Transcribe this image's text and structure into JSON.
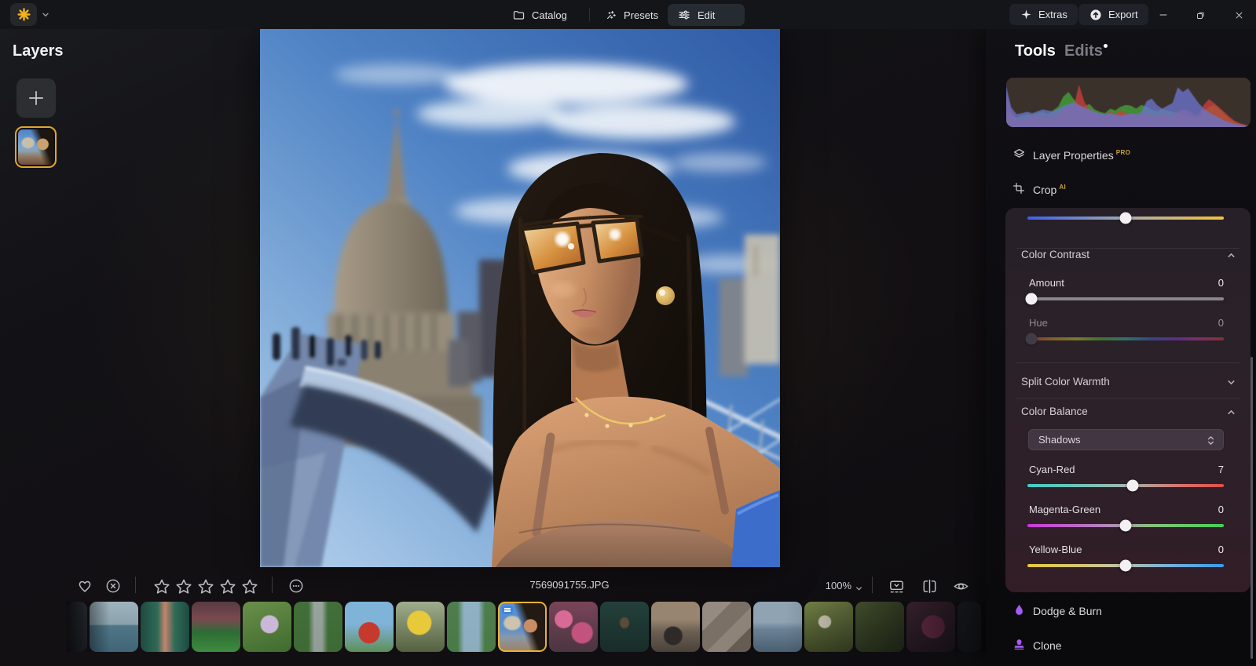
{
  "topbar": {
    "tabs": [
      {
        "label": "Catalog"
      },
      {
        "label": "Presets"
      },
      {
        "label": "Edit"
      }
    ],
    "extras_label": "Extras",
    "export_label": "Export"
  },
  "layers_panel": {
    "title": "Layers"
  },
  "viewer": {
    "filename": "7569091755.JPG",
    "zoom_level": "100%",
    "star_count": 5
  },
  "right_panel": {
    "tools_tab": "Tools",
    "edits_tab": "Edits",
    "layer_properties": {
      "label": "Layer Properties",
      "badge": "PRO"
    },
    "crop": {
      "label": "Crop",
      "badge": "AI"
    },
    "color_contrast": {
      "title": "Color Contrast",
      "amount": {
        "label": "Amount",
        "value": "0"
      },
      "hue": {
        "label": "Hue",
        "value": "0"
      }
    },
    "split_color_warmth": {
      "title": "Split Color Warmth"
    },
    "color_balance": {
      "title": "Color Balance",
      "range_selector": "Shadows",
      "cyan_red": {
        "label": "Cyan-Red",
        "value": "7"
      },
      "magenta_green": {
        "label": "Magenta-Green",
        "value": "0"
      },
      "yellow_blue": {
        "label": "Yellow-Blue",
        "value": "0"
      }
    },
    "dodge_burn": "Dodge & Burn",
    "clone": "Clone"
  },
  "histogram": {
    "red": [
      0.72,
      0.32,
      0.18,
      0.16,
      0.2,
      0.23,
      0.26,
      0.23,
      0.2,
      0.26,
      0.28,
      0.38,
      0.48,
      0.44,
      0.92,
      0.56,
      0.38,
      0.33,
      0.28,
      0.26,
      0.33,
      0.28,
      0.36,
      0.3,
      0.28,
      0.26,
      0.3,
      0.28,
      0.26,
      0.23,
      0.28,
      0.26,
      0.23,
      0.33,
      0.38,
      0.36,
      0.28,
      0.26,
      0.48,
      0.6,
      0.52,
      0.42,
      0.32,
      0.22,
      0.13,
      0.08,
      0.05,
      0.03
    ],
    "green": [
      0.34,
      0.28,
      0.2,
      0.24,
      0.28,
      0.26,
      0.3,
      0.33,
      0.28,
      0.36,
      0.44,
      0.66,
      0.76,
      0.6,
      0.48,
      0.44,
      0.5,
      0.38,
      0.33,
      0.3,
      0.4,
      0.36,
      0.44,
      0.48,
      0.46,
      0.4,
      0.48,
      0.44,
      0.38,
      0.34,
      0.4,
      0.36,
      0.33,
      0.3,
      0.27,
      0.24,
      0.22,
      0.2,
      0.34,
      0.44,
      0.48,
      0.4,
      0.28,
      0.18,
      0.11,
      0.07,
      0.04,
      0.02
    ],
    "blue": [
      0.88,
      0.42,
      0.28,
      0.3,
      0.33,
      0.3,
      0.34,
      0.38,
      0.36,
      0.34,
      0.4,
      0.46,
      0.5,
      0.54,
      0.48,
      0.42,
      0.38,
      0.33,
      0.3,
      0.28,
      0.3,
      0.27,
      0.25,
      0.27,
      0.3,
      0.28,
      0.32,
      0.56,
      0.62,
      0.48,
      0.4,
      0.46,
      0.52,
      0.86,
      0.76,
      0.84,
      0.68,
      0.52,
      0.4,
      0.32,
      0.26,
      0.2,
      0.14,
      0.1,
      0.07,
      0.05,
      0.03,
      0.02
    ]
  },
  "filmstrip": [
    {
      "name": "thumb-edge-left",
      "partial": "l",
      "bg": "linear-gradient(180deg,#3a4148,#262b31)"
    },
    {
      "name": "thumb-sea",
      "bg": "linear-gradient(180deg,#9fb3bd 0%,#8aa2ad 45%,#4f7587 48%,#3f6577 100%)"
    },
    {
      "name": "thumb-corridor",
      "bg": "linear-gradient(90deg,#1d4a41,#2f6b57 35%,#c4836f 50%,#2f6b57 70%,#1d4a41)"
    },
    {
      "name": "thumb-stadium",
      "bg": "linear-gradient(180deg,#5a3a42 0%,#7a4a50 35%,#2e6b35 60%,#3e8c3e 100%)"
    },
    {
      "name": "thumb-flower",
      "bg": "radial-gradient(circle at 55% 45%,#c9b8d8 0 22%,rgba(0,0,0,0) 25%),linear-gradient(160deg,#6a8f4a,#3f6b2f)"
    },
    {
      "name": "thumb-forest-path",
      "bg": "linear-gradient(90deg,rgba(62,107,53,.95) 0 30%,rgba(154,163,160,.9) 42% 58%,rgba(62,107,53,.95) 70%),linear-gradient(180deg,#7fae8f,#2f5429)"
    },
    {
      "name": "thumb-person-red",
      "bg": "radial-gradient(circle at 50% 62%,#c63a2e 0 26%,rgba(0,0,0,0) 28%),linear-gradient(180deg,#7fb3d8 0 45%,#5e8f5a 100%)"
    },
    {
      "name": "thumb-sunflower",
      "bg": "radial-gradient(circle at 48% 42%,#e8c93a 0 30%,rgba(0,0,0,0) 33%),linear-gradient(180deg,#9fae8f,#55603f)"
    },
    {
      "name": "thumb-canal",
      "bg": "linear-gradient(90deg,rgba(74,122,70,.95) 0 22%,rgba(143,176,196,.95) 35% 65%,rgba(74,122,70,.95) 78%),linear-gradient(180deg,#a8c4d4,#3e6b3a)"
    },
    {
      "name": "thumb-selected-portrait",
      "selected": true,
      "badge": true,
      "bg": "radial-gradient(circle at 68% 48%,#c98e63 0 16%,rgba(0,0,0,0) 18%),linear-gradient(250deg,#241a14 0 36%,rgba(0,0,0,0) 52%),radial-gradient(ellipse at 28% 42%,#cdc3ae 0 16%,rgba(0,0,0,0) 21%),linear-gradient(180deg,#5b8fce 0 55%,#8a98a8 72%,#9b8468 100%)"
    },
    {
      "name": "thumb-pink-flowers",
      "bg": "radial-gradient(circle at 30% 35%,#d86a96 0 18%,rgba(0,0,0,0) 20%),radial-gradient(circle at 68% 62%,#c2527e 0 22%,rgba(0,0,0,0) 25%),linear-gradient(180deg,#7a4458,#4a3540)"
    },
    {
      "name": "thumb-duck",
      "bg": "radial-gradient(ellipse at 50% 42%,#5a4a3a 0 12%,rgba(0,0,0,0) 15%),linear-gradient(180deg,#24403a,#182c28)"
    },
    {
      "name": "thumb-tire-sunset",
      "bg": "radial-gradient(circle at 45% 68%,#2e2a28 0 20%,rgba(0,0,0,0) 23%),linear-gradient(180deg,#98856f 0 35%,#6b5e52 60%,#4a423a 100%)"
    },
    {
      "name": "thumb-rocks",
      "bg": "linear-gradient(135deg,#958b80 0 30%,#7a7066 30% 55%,#8d8378 55% 75%,#655c52 75%)"
    },
    {
      "name": "thumb-lake-fence",
      "bg": "linear-gradient(180deg,#8fa3b3 0 40%,#6b8296 55%,#4a5f70 100%)"
    },
    {
      "name": "thumb-dandelion",
      "bg": "radial-gradient(circle at 42% 40%,#d8d4c0 0 14%,rgba(0,0,0,0) 17%),linear-gradient(180deg,#7a8a4a,#3f4a26)"
    },
    {
      "name": "thumb-grass",
      "bg": "linear-gradient(170deg,#5a6b3a,#2e3a1e)"
    },
    {
      "name": "thumb-pink-flowers-2",
      "bg": "radial-gradient(circle at 55% 50%,#c44a7e 0 30%,rgba(0,0,0,0) 33%),linear-gradient(180deg,#6b3a50,#3a2430)"
    },
    {
      "name": "thumb-edge-right",
      "partial": "r",
      "bg": "linear-gradient(180deg,#3a4148,#262b31)"
    }
  ],
  "colors": {
    "accent_yellow": "#f2b41c",
    "accent_purple": "#a55cf5",
    "edited_badge_blue": "#3f87e0"
  }
}
